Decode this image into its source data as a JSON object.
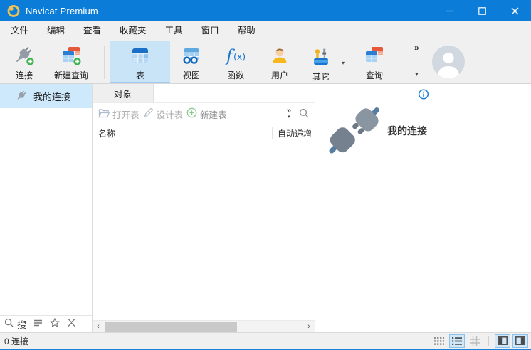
{
  "window": {
    "title": "Navicat Premium"
  },
  "menubar": {
    "items": [
      "文件",
      "编辑",
      "查看",
      "收藏夹",
      "工具",
      "窗口",
      "帮助"
    ]
  },
  "toolbar": {
    "connect": "连接",
    "new_query": "新建查询",
    "table": "表",
    "view": "视图",
    "function": "函数",
    "user": "用户",
    "other": "其它",
    "query": "查询"
  },
  "sidebar": {
    "my_connection": "我的连接",
    "search_label": "搜"
  },
  "objects_panel": {
    "tab": "对象",
    "open_table": "打开表",
    "design_table": "设计表",
    "new_table": "新建表",
    "columns": {
      "name": "名称",
      "auto_increment": "自动递增"
    }
  },
  "detail_panel": {
    "connection_name": "我的连接"
  },
  "statusbar": {
    "connection_count": "0 连接"
  },
  "icons_text": {
    "overflow_chevron": "»",
    "dropdown_arrow": "▾",
    "scroll_left": "‹",
    "scroll_right": "›"
  },
  "colors": {
    "titlebar": "#0b7cd7",
    "accent": "#0078d7",
    "selected_button_bg": "#c9e4f7",
    "sidebar_selected_bg": "#cde9fb"
  }
}
